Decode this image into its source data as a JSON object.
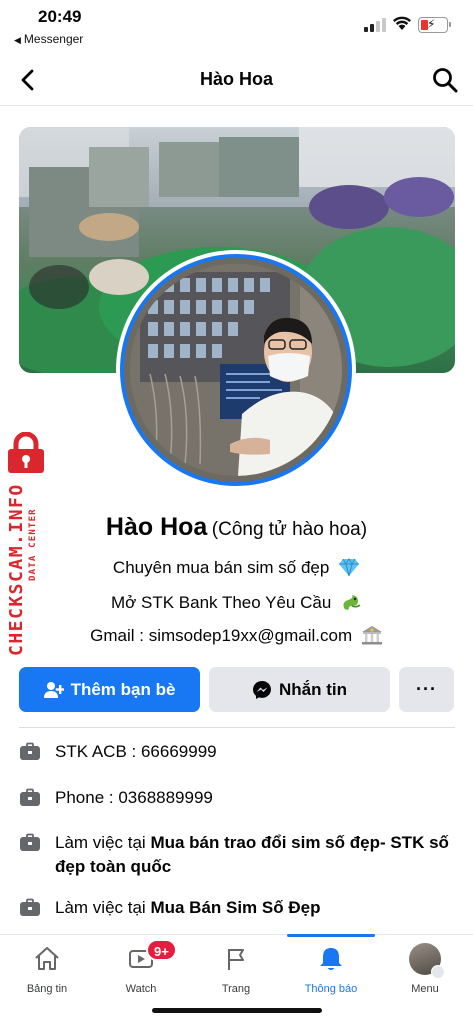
{
  "status": {
    "time": "20:49",
    "back_app": "Messenger"
  },
  "nav": {
    "title": "Hào Hoa"
  },
  "watermark": {
    "brand": "CHECKSCAM.INFO",
    "sub": "DATA CENTER"
  },
  "profile": {
    "name": "Hào Hoa",
    "alt_name": "(Công tử hào hoa)",
    "bio": [
      "Chuyên mua bán sim số đẹp",
      "Mở STK Bank Theo Yêu Cầu",
      "Gmail : simsodep19xx@gmail.com"
    ],
    "bio_emoji": [
      "gem-emoji",
      "dragon-emoji",
      "bank-emoji"
    ]
  },
  "actions": {
    "add_friend": "Thêm bạn bè",
    "message": "Nhắn tin",
    "more": "···"
  },
  "details": [
    {
      "icon": "briefcase-icon",
      "prefix": "STK ACB  : 66669999",
      "bold": ""
    },
    {
      "icon": "briefcase-icon",
      "prefix": "Phone : 0368889999",
      "bold": ""
    },
    {
      "icon": "briefcase-icon",
      "prefix": "Làm việc tại ",
      "bold": "Mua bán trao đổi sim số đẹp- STK số đẹp toàn quốc"
    },
    {
      "icon": "briefcase-icon",
      "prefix": "Làm việc tại ",
      "bold": "Mua Bán Sim Số Đẹp"
    }
  ],
  "tabs": [
    {
      "label": "Bảng tin",
      "icon": "home-icon"
    },
    {
      "label": "Watch",
      "icon": "video-icon",
      "badge": "9+"
    },
    {
      "label": "Trang",
      "icon": "flag-icon"
    },
    {
      "label": "Thông báo",
      "icon": "bell-icon",
      "active": true
    },
    {
      "label": "Menu",
      "icon": "profile-avatar"
    }
  ],
  "colors": {
    "accent": "#1877f2",
    "watermark": "#d9272d",
    "badge": "#e41e3f"
  }
}
